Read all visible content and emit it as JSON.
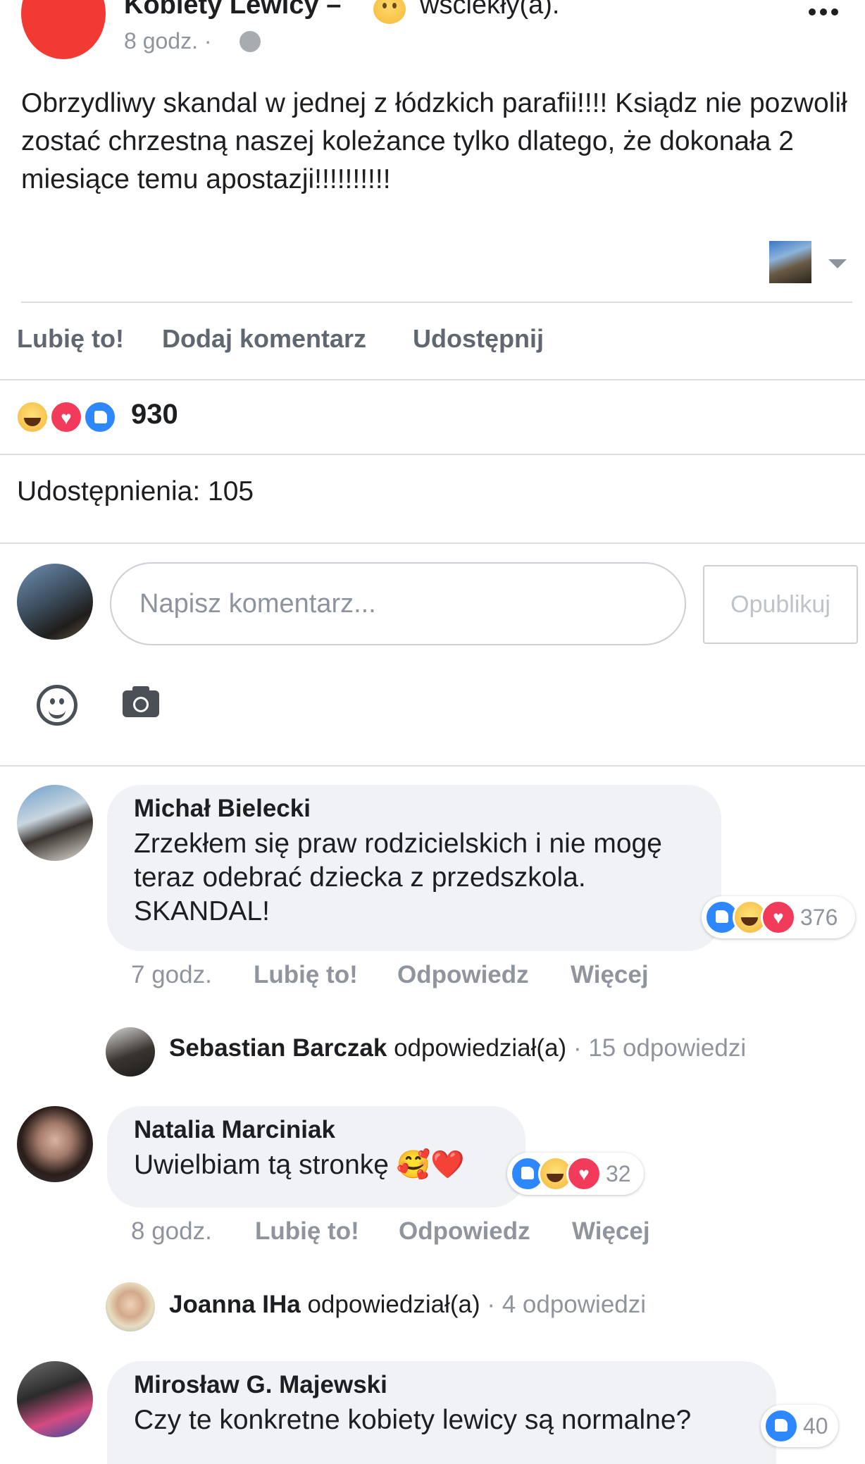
{
  "post": {
    "page_name": "Kobiety Lewicy",
    "feeling_separator": "–",
    "feeling_text": "wściekły(a).",
    "time": "8 godz. ·",
    "text": "Obrzydliwy skandal w jednej z łódzkich parafii!!!! Ksiądz nie pozwolił zostać chrzestną naszej koleżance tylko dlatego, że dokonała 2 miesiące temu apostazji!!!!!!!!!!"
  },
  "actions": {
    "like": "Lubię to!",
    "comment": "Dodaj komentarz",
    "share": "Udostępnij"
  },
  "reactions": {
    "count": "930",
    "types": [
      "haha",
      "love",
      "like"
    ]
  },
  "shares": "Udostępnienia: 105",
  "composer": {
    "placeholder": "Napisz komentarz...",
    "publish": "Opublikuj"
  },
  "comments": [
    {
      "author": "Michał Bielecki",
      "text": "Zrzekłem się praw rodzicielskich i nie mogę teraz odebrać dziecka z przedszkola. SKANDAL!",
      "reaction_count": "376",
      "reactions": [
        "like",
        "haha",
        "love"
      ],
      "time": "7 godz.",
      "like": "Lubię to!",
      "reply": "Odpowiedz",
      "more": "Więcej",
      "replies": {
        "name": "Sebastian Barczak",
        "verb": "odpowiedział(a)",
        "count": "· 15 odpowiedzi"
      }
    },
    {
      "author": "Natalia Marciniak",
      "text": "Uwielbiam tą stronkę 🥰❤️",
      "reaction_count": "32",
      "reactions": [
        "like",
        "haha",
        "love"
      ],
      "time": "8 godz.",
      "like": "Lubię to!",
      "reply": "Odpowiedz",
      "more": "Więcej",
      "replies": {
        "name": "Joanna IHa",
        "verb": "odpowiedział(a)",
        "count": "· 4 odpowiedzi"
      }
    },
    {
      "author": "Mirosław G. Majewski",
      "text": "Czy te konkretne kobiety lewicy są normalne?",
      "reaction_count": "40",
      "reactions": [
        "like"
      ]
    }
  ],
  "colors": {
    "page_avatar": "#f23a34",
    "secondary_text": "#90949c",
    "action_text": "#606770",
    "bubble": "#f0f2f5",
    "like_blue": "#2d88ff",
    "love_red": "#f23a5a"
  }
}
